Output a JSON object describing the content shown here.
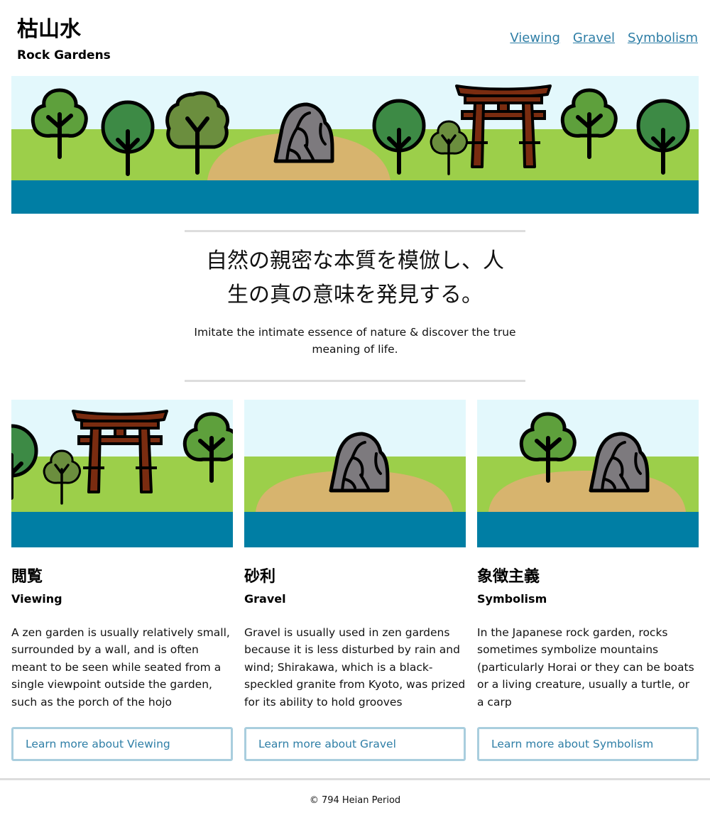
{
  "header": {
    "title_jp": "枯山水",
    "title_en": "Rock Gardens",
    "nav": [
      "Viewing",
      "Gravel",
      "Symbolism"
    ]
  },
  "intro": {
    "tagline_jp_line1": "自然の親密な本質を模倣し、人",
    "tagline_jp_line2": "生の真の意味を発見する。",
    "tagline_en": "Imitate the intimate essence of nature & discover the true meaning of life."
  },
  "cards": [
    {
      "title_jp": "閲覧",
      "title_en": "Viewing",
      "text": "A zen garden is usually relatively small, surrounded by a wall, and is often meant to be seen while seated from a single viewpoint outside the garden, such as the porch of the hojo",
      "button": "Learn more about Viewing"
    },
    {
      "title_jp": "砂利",
      "title_en": "Gravel",
      "text": "Gravel is usually used in zen gardens because it is less disturbed by rain and wind; Shirakawa, which is a black-speckled granite from Kyoto, was prized for its ability to hold grooves",
      "button": "Learn more about Gravel"
    },
    {
      "title_jp": "象徴主義",
      "title_en": "Symbolism",
      "text": "In the Japanese rock garden, rocks sometimes symbolize mountains (particularly Horai or they can be boats or a living creature, usually a turtle, or a carp",
      "button": "Learn more about Symbolism"
    }
  ],
  "footer": {
    "text": "© 794 Heian Period"
  },
  "icons": {
    "hero": [
      "tree-icon",
      "tree-icon",
      "tree-icon",
      "rock-icon",
      "tree-icon",
      "tree-icon",
      "torii-gate-icon",
      "tree-icon",
      "tree-icon"
    ],
    "card_viewing": [
      "tree-icon",
      "tree-icon",
      "torii-gate-icon",
      "tree-icon"
    ],
    "card_gravel": [
      "rock-icon"
    ],
    "card_symbolism": [
      "tree-icon",
      "rock-icon"
    ]
  },
  "colors": {
    "sky": "#e3f8fc",
    "grass": "#9ccf4a",
    "sand": "#d7b46e",
    "water": "#007ea4",
    "tree_light": "#5ea03c",
    "tree_dark": "#3d8a45",
    "tree_olive": "#6b8e3e",
    "rock": "#7d7a7e",
    "torii": "#7a2c10",
    "link": "#2e7ea6",
    "button_border": "#a9cede",
    "rule": "#dddddd"
  }
}
